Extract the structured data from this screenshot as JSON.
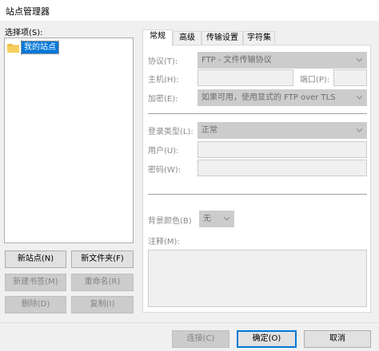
{
  "window": {
    "title": "站点管理器"
  },
  "left": {
    "select_label": "选择项(S):",
    "tree": [
      {
        "label": "我的站点",
        "icon": "folder-icon",
        "selected": true
      }
    ],
    "buttons": {
      "new_site": "新站点(N)",
      "new_folder": "新文件夹(F)",
      "new_bookmark": "新建书签(M)",
      "rename": "重命名(R)",
      "delete": "删除(D)",
      "copy": "复制(I)"
    }
  },
  "tabs": [
    {
      "label": "常规",
      "active": true
    },
    {
      "label": "高级",
      "active": false
    },
    {
      "label": "传输设置",
      "active": false
    },
    {
      "label": "字符集",
      "active": false
    }
  ],
  "general": {
    "protocol_label": "协议(T):",
    "protocol_value": "FTP - 文件传输协议",
    "host_label": "主机(H):",
    "host_value": "",
    "port_label": "端口(P):",
    "port_value": "",
    "encryption_label": "加密(E):",
    "encryption_value": "如果可用，使用显式的 FTP over TLS",
    "logon_type_label": "登录类型(L):",
    "logon_type_value": "正常",
    "user_label": "用户(U):",
    "user_value": "",
    "password_label": "密码(W):",
    "password_value": "",
    "bg_color_label": "背景颜色(B)",
    "bg_color_value": "无",
    "comments_label": "注释(M):",
    "comments_value": ""
  },
  "footer": {
    "connect": "连接(C)",
    "ok": "确定(O)",
    "cancel": "取消"
  },
  "colors": {
    "selection": "#0078d7",
    "folder": "#f0c04a"
  }
}
